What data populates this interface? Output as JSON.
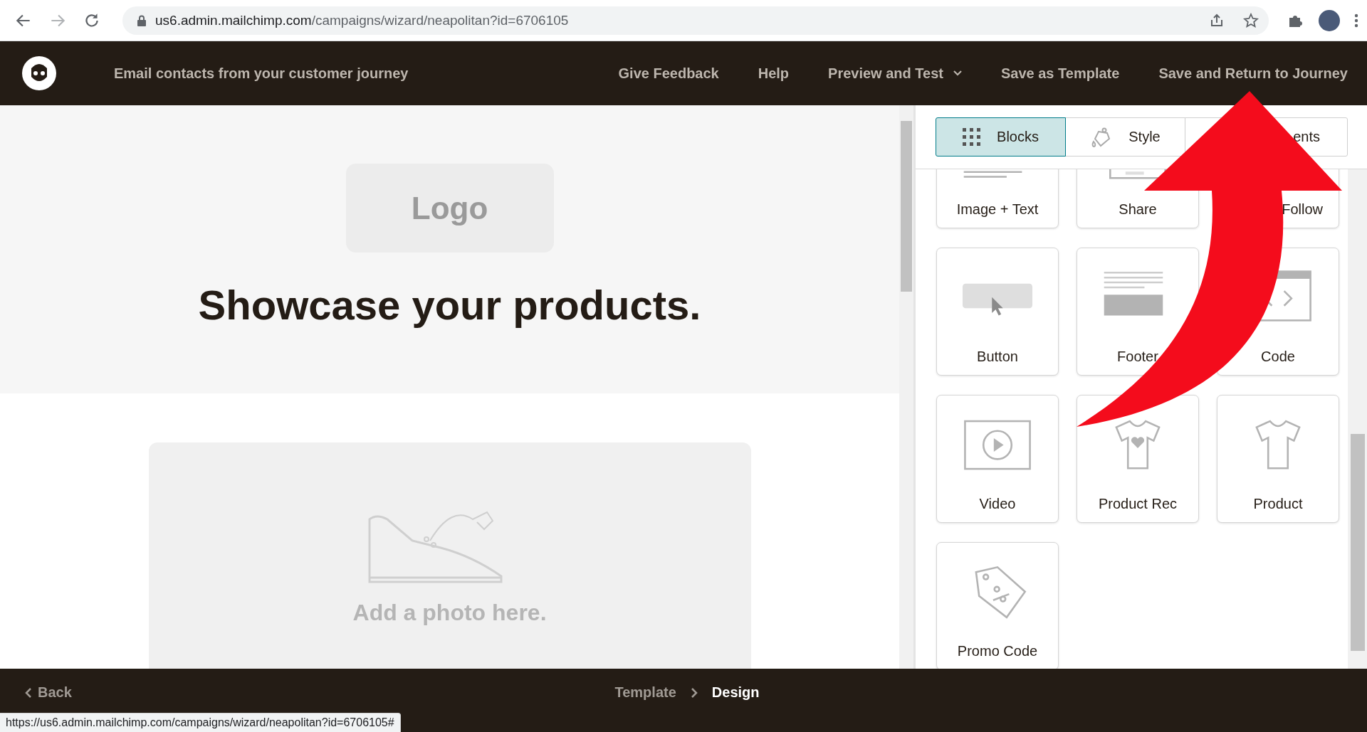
{
  "browser": {
    "url_host": "us6.admin.mailchimp.com",
    "url_path": "/campaigns/wizard/neapolitan?id=6706105"
  },
  "header": {
    "title": "Email contacts from your customer journey",
    "actions": [
      {
        "label": "Give Feedback",
        "kind": "link"
      },
      {
        "label": "Help",
        "kind": "link"
      },
      {
        "label": "Preview and Test",
        "kind": "dropdown"
      },
      {
        "label": "Save as Template",
        "kind": "link"
      },
      {
        "label": "Save and Return to Journey",
        "kind": "link"
      }
    ]
  },
  "canvas": {
    "logo": "Logo",
    "heading": "Showcase your products.",
    "photo_hint": "Add a photo here."
  },
  "panel": {
    "tabs": [
      {
        "label": "Blocks",
        "kind": "blocks",
        "selected": true
      },
      {
        "label": "Style",
        "kind": "style",
        "selected": false
      },
      {
        "label": "ents",
        "kind": "covered",
        "selected": false
      }
    ],
    "blocks": [
      {
        "label": "Image + Text",
        "kind": "image-text"
      },
      {
        "label": "Share",
        "kind": "share"
      },
      {
        "label": "Follow",
        "kind": "follow"
      },
      {
        "label": "Button",
        "kind": "button"
      },
      {
        "label": "Footer",
        "kind": "footer"
      },
      {
        "label": "Code",
        "kind": "code"
      },
      {
        "label": "Video",
        "kind": "video"
      },
      {
        "label": "Product Rec",
        "kind": "product-rec"
      },
      {
        "label": "Product",
        "kind": "product"
      },
      {
        "label": "Promo Code",
        "kind": "promo"
      }
    ]
  },
  "footer": {
    "back": "Back",
    "steps": [
      {
        "label": "Template",
        "selected": false
      },
      {
        "label": "Design",
        "selected": true
      }
    ]
  },
  "status_url": "https://us6.admin.mailchimp.com/campaigns/wizard/neapolitan?id=6706105#"
}
